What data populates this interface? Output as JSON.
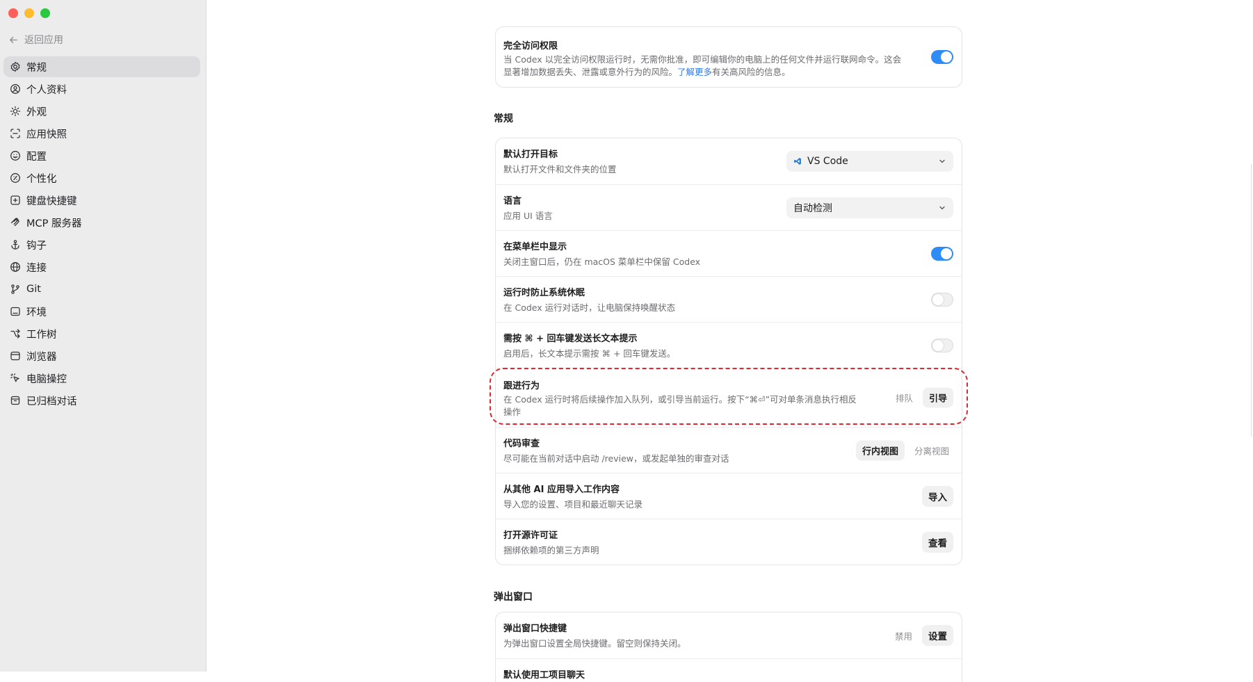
{
  "colors": {
    "accent": "#2f8bf5",
    "link": "#2f7af5",
    "highlight_dash": "#e0262f"
  },
  "sidebar": {
    "back_label": "返回应用",
    "items": [
      {
        "label": "常规",
        "icon": "gear-icon"
      },
      {
        "label": "个人资料",
        "icon": "user-circle-icon"
      },
      {
        "label": "外观",
        "icon": "sun-icon"
      },
      {
        "label": "应用快照",
        "icon": "snapshot-icon"
      },
      {
        "label": "配置",
        "icon": "config-icon"
      },
      {
        "label": "个性化",
        "icon": "personalize-icon"
      },
      {
        "label": "键盘快捷键",
        "icon": "keyboard-icon"
      },
      {
        "label": "MCP 服务器",
        "icon": "mcp-icon"
      },
      {
        "label": "钩子",
        "icon": "anchor-icon"
      },
      {
        "label": "连接",
        "icon": "globe-icon"
      },
      {
        "label": "Git",
        "icon": "git-branch-icon"
      },
      {
        "label": "环境",
        "icon": "monitor-icon"
      },
      {
        "label": "工作树",
        "icon": "worktree-icon"
      },
      {
        "label": "浏览器",
        "icon": "browser-icon"
      },
      {
        "label": "电脑操控",
        "icon": "cursor-icon"
      },
      {
        "label": "已归档对话",
        "icon": "archive-icon"
      }
    ]
  },
  "top_card": {
    "title": "完全访问权限",
    "desc_line1": "当 Codex 以完全访问权限运行时，无需你批准，即可编辑你的电脑上的任何文件并运行联网命令。这会",
    "desc_line2_pre": "显著增加数据丢失、泄露或意外行为的风险。",
    "desc_link": "了解更多",
    "desc_line2_post": "有关高风险的信息。",
    "toggle_on": true
  },
  "general": {
    "section_title": "常规",
    "default_open": {
      "title": "默认打开目标",
      "desc": "默认打开文件和文件夹的位置",
      "value": "VS Code"
    },
    "language": {
      "title": "语言",
      "desc": "应用 UI 语言",
      "value": "自动检测"
    },
    "menubar": {
      "title": "在菜单栏中显示",
      "desc": "关闭主窗口后，仍在 macOS 菜单栏中保留 Codex",
      "toggle_on": true
    },
    "prevent_sleep": {
      "title": "运行时防止系统休眠",
      "desc": "在 Codex 运行对话时，让电脑保持唤醒状态",
      "toggle_on": false
    },
    "cmd_enter": {
      "title": "需按 ⌘ + 回车键发送长文本提示",
      "desc": "启用后，长文本提示需按 ⌘ + 回车键发送。",
      "toggle_on": false
    },
    "follow_up": {
      "title": "跟进行为",
      "desc_line1": "在 Codex 运行时将后续操作加入队列，或引导当前运行。按下“⌘⏎”可对单条消息执行相反",
      "desc_line2": "操作",
      "option_queue": "排队",
      "option_steer": "引导"
    },
    "code_review": {
      "title": "代码审查",
      "desc": "尽可能在当前对话中启动 /review，或发起单独的审查对话",
      "option_inline": "行内视图",
      "option_split": "分离视图"
    },
    "import": {
      "title": "从其他 AI 应用导入工作内容",
      "desc": "导入您的设置、项目和最近聊天记录",
      "button": "导入"
    },
    "licenses": {
      "title": "打开源许可证",
      "desc": "捆绑依赖项的第三方声明",
      "button": "查看"
    }
  },
  "popup": {
    "section_title": "弹出窗口",
    "shortcut": {
      "title": "弹出窗口快捷键",
      "desc": "为弹出窗口设置全局快捷键。留空则保持关闭。",
      "status": "禁用",
      "button": "设置"
    },
    "partial_title": "默认使用工项目聊天"
  }
}
